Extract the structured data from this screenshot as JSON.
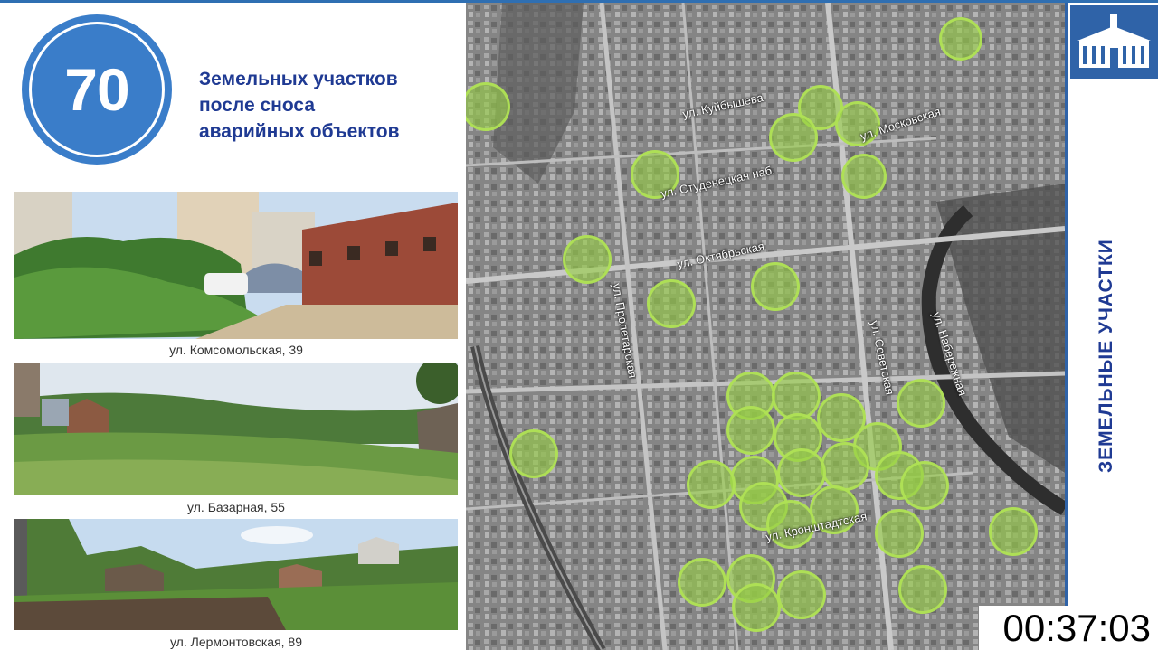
{
  "badge": {
    "number": "70"
  },
  "headline": {
    "line1": "Земельных участков",
    "line2": "после сноса",
    "line3": "аварийных объектов"
  },
  "photos": [
    {
      "caption": "ул. Комсомольская, 39"
    },
    {
      "caption": "ул. Базарная, 55"
    },
    {
      "caption": "ул. Лермонтовская, 89"
    }
  ],
  "map": {
    "streets": {
      "kuibysheva": "ул. Куйбышева",
      "moskovskaya": "ул. Московская",
      "studenetskaya": "ул. Студенецкая наб.",
      "oktyabrskaya": "ул. Октябрьская",
      "proletarskaya": "ул. Пролетарская",
      "sovetskaya": "ул. Советская",
      "naberezhnaya": "ул. Набережная",
      "kronshtadtskaya": "ул. Кронштадтская"
    },
    "parcel_color": "#96cd46"
  },
  "sidebar": {
    "title": "ЗЕМЕЛЬНЫЕ УЧАСТКИ"
  },
  "timer": "00:37:03",
  "colors": {
    "accent_blue": "#3a7dc9",
    "title_blue": "#1f3a93"
  }
}
